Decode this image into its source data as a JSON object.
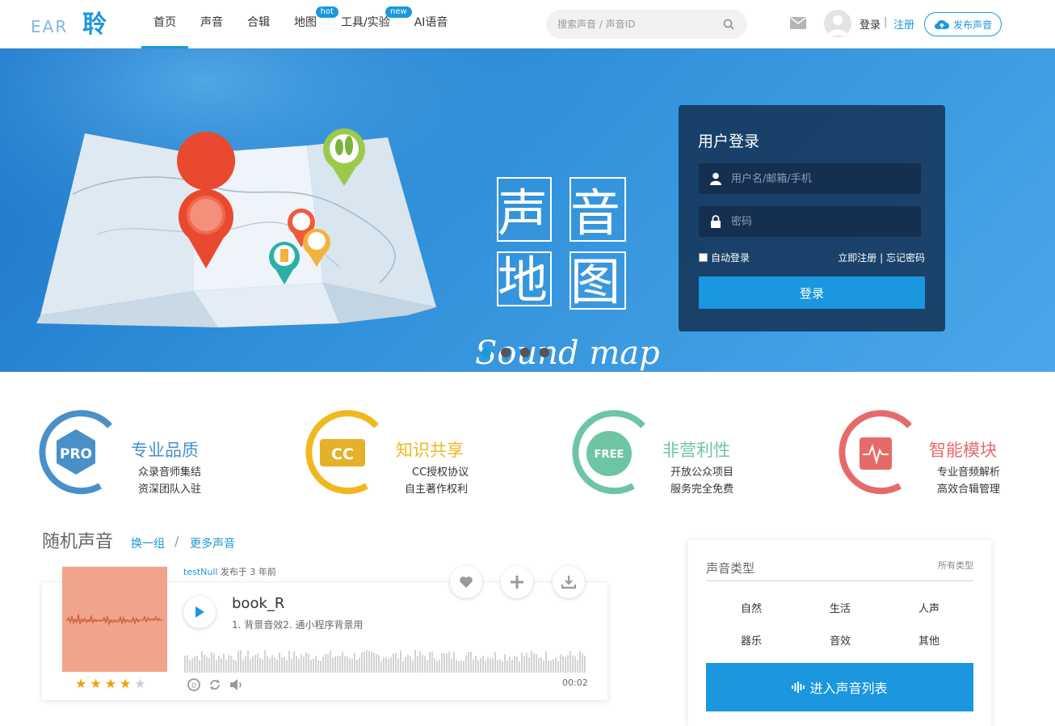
{
  "header": {
    "logo_text": "EAR聆",
    "nav": [
      {
        "label": "首页"
      },
      {
        "label": "声音"
      },
      {
        "label": "合辑"
      },
      {
        "label": "地图",
        "badge": "hot"
      },
      {
        "label": "工具/实验",
        "badge": "new"
      },
      {
        "label": "AI语音"
      }
    ],
    "search_placeholder": "搜索声音 / 声音ID",
    "login": "登录",
    "separator": "|",
    "register": "注册",
    "publish": "发布声音"
  },
  "banner": {
    "art_title_chars": [
      "声",
      "音",
      "地",
      "图"
    ],
    "art_subtitle": "Sound map",
    "slide_count": 4,
    "active_slide": 1
  },
  "login_panel": {
    "title": "用户登录",
    "username_placeholder": "用户名/邮箱/手机",
    "password_placeholder": "密码",
    "auto_login": "自动登录",
    "register_now": "立即注册",
    "separator": "|",
    "forgot_password": "忘记密码",
    "submit": "登录"
  },
  "features": [
    {
      "badge": "PRO",
      "title": "专业品质",
      "line1": "众录音师集结",
      "line2": "资深团队入驻",
      "color": "#4a90c8"
    },
    {
      "badge": "CC",
      "title": "知识共享",
      "line1": "CC授权协议",
      "line2": "自主著作权利",
      "color": "#f0b81e"
    },
    {
      "badge": "FREE",
      "title": "非营利性",
      "line1": "开放公众项目",
      "line2": "服务完全免费",
      "color": "#6ec5a3"
    },
    {
      "badge": "pulse-icon",
      "title": "智能模块",
      "line1": "专业音频解析",
      "line2": "高效合辑管理",
      "color": "#e66a6a"
    }
  ],
  "random_section": {
    "title": "随机声音",
    "refresh": "换一组",
    "slash": "/",
    "more": "更多声音"
  },
  "sound": {
    "author": "testNull",
    "published": "发布于 3 年前",
    "name": "book_R",
    "description": "1. 背景音效2. 通小程序背景用",
    "duration": "00:02",
    "rating": 4,
    "rating_max": 5,
    "cover_color": "#f0a48c"
  },
  "category_panel": {
    "title": "声音类型",
    "all": "所有类型",
    "items": [
      "自然",
      "生活",
      "人声",
      "器乐",
      "音效",
      "其他"
    ],
    "enter": "进入声音列表"
  },
  "colors": {
    "accent": "#1a97de"
  }
}
